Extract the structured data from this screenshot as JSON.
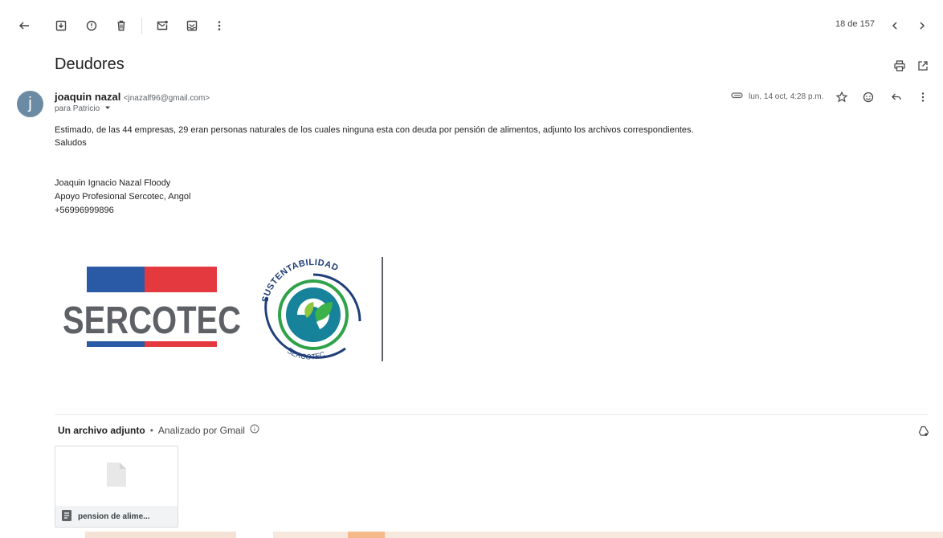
{
  "toolbar": {
    "counter": "18 de 157"
  },
  "email": {
    "subject": "Deudores",
    "avatar_letter": "j",
    "sender_name": "joaquin nazal",
    "sender_email": "<jnazalf96@gmail.com>",
    "to": "para Patricio",
    "date": "lun, 14 oct, 4:28 p.m.",
    "body_line1": "Estimado, de las 44 empresas, 29 eran personas naturales de los cuales ninguna esta con deuda por pensión de alimentos, adjunto los archivos correspondientes.",
    "body_line2": "Saludos",
    "sig_line1": "Joaquin Ignacio Nazal Floody",
    "sig_line2": "Apoyo Profesional Sercotec, Angol",
    "sig_line3": "+56996999896"
  },
  "logo": {
    "brand_text": "SERCOTEC",
    "ring_top_text": "SUSTENTABILIDAD",
    "ring_bottom_text": "SERCOTEC",
    "colors": {
      "blue": "#2a5aa6",
      "red": "#e43a3f",
      "gray": "#5d6166",
      "navy": "#1f3f78",
      "green": "#2fa24a",
      "teal": "#16839a"
    }
  },
  "attachments": {
    "title": "Un archivo adjunto",
    "separator": "•",
    "scanned": "Analizado por Gmail",
    "file_name": "pension de alime..."
  }
}
